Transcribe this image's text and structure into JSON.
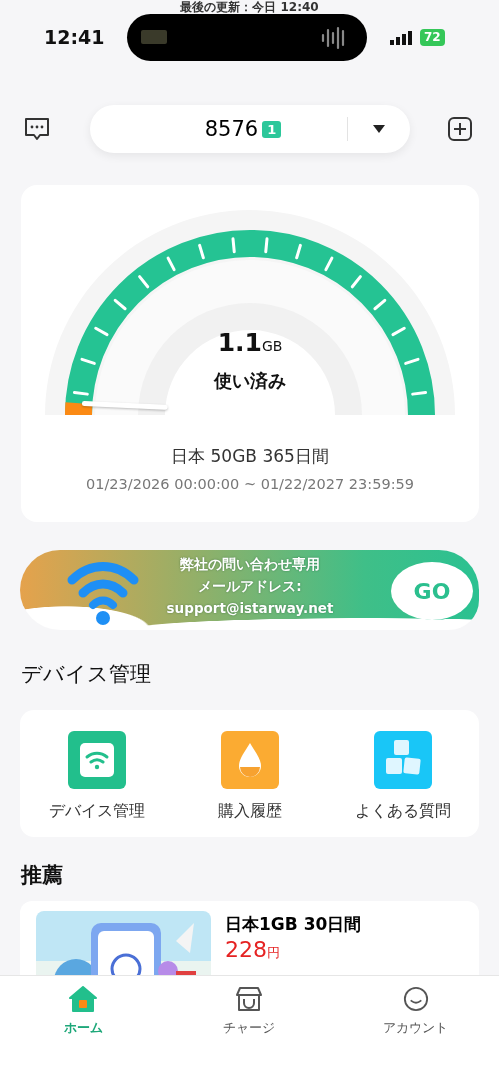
{
  "status_bar": {
    "time": "12:41",
    "battery": "72"
  },
  "last_updated": "最後の更新：今日 12:40",
  "header": {
    "device": "8576",
    "badge": "1"
  },
  "usage": {
    "amount": "1.1",
    "unit": "GB",
    "label": "使い済み",
    "plan": "日本 50GB 365日間",
    "period": "01/23/2026 00:00:00 ~ 01/22/2027 23:59:59"
  },
  "banner": {
    "lines": [
      "弊社の問い合わせ専用",
      "メールアドレス:",
      "support@istarway.net"
    ],
    "button": "GO"
  },
  "device_section": {
    "title": "デバイス管理",
    "items": [
      {
        "label": "デバイス管理",
        "kind": "wifi"
      },
      {
        "label": "購入履歴",
        "kind": "drop"
      },
      {
        "label": "よくある質問",
        "kind": "qa"
      }
    ]
  },
  "recommend": {
    "title": "推薦",
    "products": [
      {
        "name": "日本1GB 30日間",
        "price": "228",
        "currency": "円"
      }
    ]
  },
  "tabs": [
    {
      "label": "ホーム",
      "kind": "home",
      "selected": true
    },
    {
      "label": "チャージ",
      "kind": "shop",
      "selected": false
    },
    {
      "label": "アカウント",
      "kind": "face",
      "selected": false
    }
  ]
}
